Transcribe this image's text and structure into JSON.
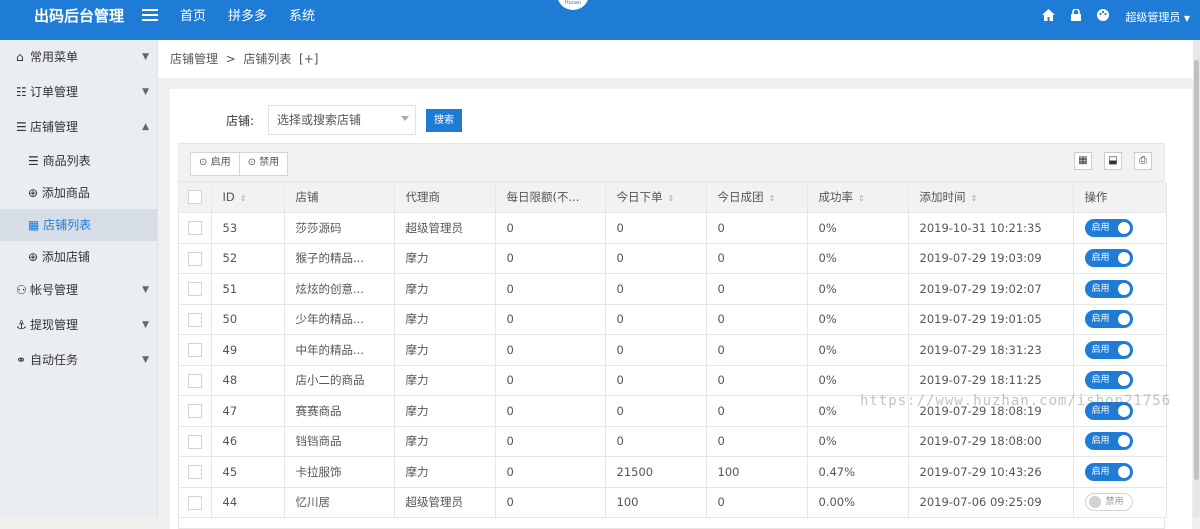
{
  "app": {
    "title": "出码后台管理",
    "logo_text": "Hunan"
  },
  "topnav": {
    "items": [
      "首页",
      "拼多多",
      "系统"
    ]
  },
  "topbar": {
    "user": "超级管理员"
  },
  "sidebar": {
    "items": [
      {
        "label": "常用菜单",
        "icon": "home-icon"
      },
      {
        "label": "订单管理",
        "icon": "database-icon"
      },
      {
        "label": "店铺管理",
        "icon": "list-icon",
        "expanded": true,
        "children": [
          {
            "label": "商品列表",
            "icon": "list-icon"
          },
          {
            "label": "添加商品",
            "icon": "add-circle-icon"
          },
          {
            "label": "店铺列表",
            "icon": "grid-icon",
            "active": true
          },
          {
            "label": "添加店铺",
            "icon": "add-circle-icon"
          }
        ]
      },
      {
        "label": "帐号管理",
        "icon": "user-icon"
      },
      {
        "label": "提现管理",
        "icon": "anchor-icon"
      },
      {
        "label": "自动任务",
        "icon": "link-icon"
      }
    ]
  },
  "breadcrumb": {
    "parent": "店铺管理",
    "sep": ">",
    "current": "店铺列表",
    "extra": "[+]"
  },
  "search": {
    "label": "店铺:",
    "placeholder": "选择或搜索店铺",
    "button": "搜索"
  },
  "toolbar": {
    "enable": "启用",
    "disable": "禁用"
  },
  "table": {
    "headers": [
      "ID",
      "店铺",
      "代理商",
      "每日限额(不...",
      "今日下单",
      "今日成团",
      "成功率",
      "添加时间",
      "操作"
    ],
    "rows": [
      {
        "id": "53",
        "shop": "莎莎源码",
        "agent": "超级管理员",
        "limit": "0",
        "orders": "0",
        "groups": "0",
        "rate": "0%",
        "time": "2019-10-31 10:21:35",
        "status": "启用",
        "on": true
      },
      {
        "id": "52",
        "shop": "猴子的精品...",
        "agent": "摩力",
        "limit": "0",
        "orders": "0",
        "groups": "0",
        "rate": "0%",
        "time": "2019-07-29 19:03:09",
        "status": "启用",
        "on": true
      },
      {
        "id": "51",
        "shop": "炫炫的创意...",
        "agent": "摩力",
        "limit": "0",
        "orders": "0",
        "groups": "0",
        "rate": "0%",
        "time": "2019-07-29 19:02:07",
        "status": "启用",
        "on": true
      },
      {
        "id": "50",
        "shop": "少年的精品...",
        "agent": "摩力",
        "limit": "0",
        "orders": "0",
        "groups": "0",
        "rate": "0%",
        "time": "2019-07-29 19:01:05",
        "status": "启用",
        "on": true
      },
      {
        "id": "49",
        "shop": "中年的精品...",
        "agent": "摩力",
        "limit": "0",
        "orders": "0",
        "groups": "0",
        "rate": "0%",
        "time": "2019-07-29 18:31:23",
        "status": "启用",
        "on": true
      },
      {
        "id": "48",
        "shop": "店小二的商品",
        "agent": "摩力",
        "limit": "0",
        "orders": "0",
        "groups": "0",
        "rate": "0%",
        "time": "2019-07-29 18:11:25",
        "status": "启用",
        "on": true
      },
      {
        "id": "47",
        "shop": "赛赛商品",
        "agent": "摩力",
        "limit": "0",
        "orders": "0",
        "groups": "0",
        "rate": "0%",
        "time": "2019-07-29 18:08:19",
        "status": "启用",
        "on": true
      },
      {
        "id": "46",
        "shop": "铛铛商品",
        "agent": "摩力",
        "limit": "0",
        "orders": "0",
        "groups": "0",
        "rate": "0%",
        "time": "2019-07-29 18:08:00",
        "status": "启用",
        "on": true
      },
      {
        "id": "45",
        "shop": "卡拉服饰",
        "agent": "摩力",
        "limit": "0",
        "orders": "21500",
        "groups": "100",
        "rate": "0.47%",
        "time": "2019-07-29 10:43:26",
        "status": "启用",
        "on": true
      },
      {
        "id": "44",
        "shop": "忆川居",
        "agent": "超级管理员",
        "limit": "0",
        "orders": "100",
        "groups": "0",
        "rate": "0.00%",
        "time": "2019-07-06 09:25:09",
        "status": "禁用",
        "on": false
      }
    ]
  },
  "watermark": "https://www.huzhan.com/ishop21756",
  "colors": {
    "primary": "#1E7BD6",
    "sidebar_bg": "#eaedf1",
    "active_bg": "#d6dde7"
  }
}
